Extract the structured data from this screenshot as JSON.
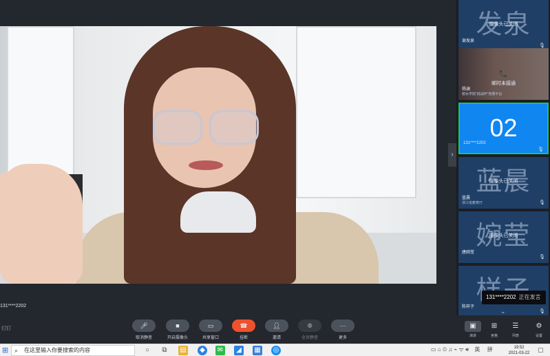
{
  "main": {
    "speaker_caption": "131****2202",
    "expand_arrow": "›"
  },
  "sidebar": {
    "tiles": [
      {
        "big": "发泉",
        "overlay": "摄像头已关闭",
        "name": "谢发泉",
        "sub": "",
        "mic": "🎙"
      },
      {
        "big": "",
        "overlay": "邮时未接通",
        "phone": "📞",
        "name": "杨澜",
        "sub": "丽水学院“挑战杯”竞赛平台",
        "mic": ""
      },
      {
        "big": "02",
        "overlay": "",
        "name": "131****2202",
        "sub": "",
        "mic": "🎙"
      },
      {
        "big": "蓝晨",
        "overlay": "摄像头已关闭",
        "name": "蓝晨",
        "sub": "浙江省教育厅",
        "mic": "🎙"
      },
      {
        "big": "婉莹",
        "overlay": "摄像头已关闭",
        "name": "唐婉莹",
        "sub": "",
        "mic": "🎙"
      },
      {
        "big": "样子",
        "overlay": "",
        "name": "陈样子",
        "sub": "",
        "mic": "🎙"
      }
    ],
    "speaking_badge": {
      "name": "131****2202",
      "status": "正在发言"
    },
    "down_arrow": "⌄"
  },
  "toolbar": {
    "logo": "钉钉",
    "buttons": [
      {
        "label": "取消静音",
        "icon": "🎤︎"
      },
      {
        "label": "开启摄像头",
        "icon": "■"
      },
      {
        "label": "共享窗口",
        "icon": "▭"
      },
      {
        "label": "挂断",
        "icon": "☎"
      },
      {
        "label": "邀请",
        "icon": "👤︎"
      },
      {
        "label": "全员静音",
        "icon": "⚉"
      },
      {
        "label": "更多",
        "icon": "···"
      }
    ],
    "view_buttons": [
      {
        "label": "演讲",
        "icon": "▣"
      },
      {
        "label": "宫格",
        "icon": "⊞"
      },
      {
        "label": "列表",
        "icon": "☰"
      },
      {
        "label": "设置",
        "icon": "⚙"
      }
    ]
  },
  "taskbar": {
    "search_placeholder": "在这里输入你要搜索的内容",
    "tray_lang": "英",
    "tray_ime": "拼",
    "time": "19:52",
    "date": "2021-03-22"
  },
  "colors": {
    "accent_blue": "#0f86f0",
    "active_border": "#21c45a",
    "hangup_red": "#f0512d",
    "tile_bg": "#1f3f66"
  }
}
